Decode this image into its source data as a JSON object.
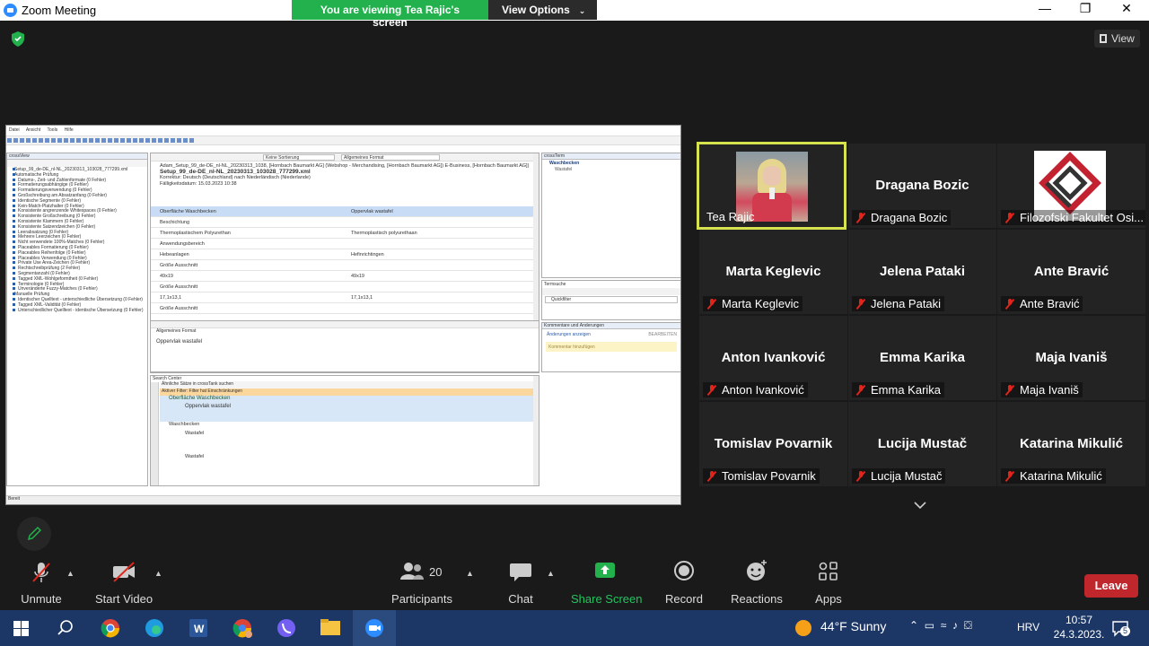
{
  "window": {
    "title": "Zoom Meeting"
  },
  "banner": {
    "viewing": "You are viewing Tea Rajic's screen",
    "view_options": "View Options"
  },
  "view_button": "View",
  "shared_screen": {
    "menu": [
      "Datei",
      "Ansicht",
      "Tools",
      "Hilfe"
    ],
    "left_pane_title": "crossView",
    "tree_items": [
      "Setup_99_de-DE_nl-NL_20230313_103028_777299.xml",
      "Automatische Prüfung",
      "Datums-, Zeit- und Zahlenformate (0 Fehler)",
      "Formatierungsabhängige (0 Fehler)",
      "Formatierungsverwendung (0 Fehler)",
      "Großschreibung am Absatzanfang (0 Fehler)",
      "Identische Segmente (0 Fehler)",
      "Kein-Match-Platzhalter (0 Fehler)",
      "Konsistente angrenzende Whitespaces (0 Fehler)",
      "Konsistente Großschreibung (0 Fehler)",
      "Konsistente Klammern (0 Fehler)",
      "Konsistente Satzendzeichen (0 Fehler)",
      "Leerabsatzung (0 Fehler)",
      "Mehrere Leerzeichen (0 Fehler)",
      "Nicht verwendete 100%-Matches (0 Fehler)",
      "Placeables Formatierung (0 Fehler)",
      "Placeables Reihenfolge (0 Fehler)",
      "Placeables Verwendung (0 Fehler)",
      "Private Use Area-Zeichen (0 Fehler)",
      "Rechtschreibprüfung (2 Fehler)",
      "Segmentanzahl (0 Fehler)",
      "Tagged XML-Wohlgeformtheit (0 Fehler)",
      "Terminologie (0 Fehler)",
      "Unveränderte Fuzzy-Matches (0 Fehler)",
      "Manuelle Prüfung",
      "Identischer Quelltext - unterschiedliche Übersetzung (0 Fehler)",
      "Tagged XML-Validität (0 Fehler)",
      "Unterschiedlicher Quelltext - identische Übersetzung (0 Fehler)"
    ],
    "toolbar_sort": "Keine Sortierung",
    "toolbar_format": "Allgemeines Format",
    "header_lines": [
      "Adam_Setup_99_de-DE_nl-NL_20230313_1038, [Hornbach Baumarkt AG] (Webshop - Merchandising, [Hornbach Baumarkt AG]) E-Business, [Hornbach Baumarkt AG])",
      "Setup_99_de-DE_nl-NL_20230313_103028_777299.xml",
      "Korrektur: Deutsch (Deutschland) nach Niederländisch (Niederlande)",
      "Fälligkeitsdatum: 15.03.2023 10:38"
    ],
    "segments": [
      {
        "src": "Oberfläche Waschbecken",
        "tgt": "Oppervlak wastafel"
      },
      {
        "src": "Beschichtung",
        "tgt": ""
      },
      {
        "src": "Thermoplastischem Polyurethan",
        "tgt": "Thermoplastisch polyurethaan"
      },
      {
        "src": "Anwendungsbereich",
        "tgt": ""
      },
      {
        "src": "Hebeanlagen",
        "tgt": "Hefinrichtingen"
      },
      {
        "src": "Größe Ausschnitt",
        "tgt": ""
      },
      {
        "src": "49x19",
        "tgt": "49x19"
      },
      {
        "src": "Größe Ausschnitt",
        "tgt": ""
      },
      {
        "src": "17,1x13,1",
        "tgt": "17,1x13,1"
      },
      {
        "src": "Größe Ausschnitt",
        "tgt": ""
      }
    ],
    "edit_format": "Allgemeines Format",
    "edit_text": "Oppervlak wastafel",
    "right_pane_title": "crossTerm",
    "term_items": [
      "Waschbecken",
      "Wastafel"
    ],
    "termsuche": "Termsuche",
    "quickfilter": "Quickfilter",
    "comments_title": "Kommentare und Änderungen",
    "changes_label": "Änderungen anzeigen",
    "edit_label": "BEARBEITEN",
    "comment_placeholder": "Kommentar hinzufügen",
    "search_center": "Search Center",
    "search_similar": "Ähnliche Sätze in crossTank suchen",
    "active_filter": "Aktiver Filter: Filter hat Einschränkungen",
    "results": [
      "Oberfläche Waschbecken",
      "Oppervlak wastafel",
      "Waschbecken",
      "Wastafel",
      "Wastafel"
    ],
    "status": "Bereit"
  },
  "participants": [
    {
      "name": "Tea Rajic",
      "big": ""
    },
    {
      "name": "Dragana Bozic",
      "big": "Dragana Bozic"
    },
    {
      "name": "Filozofski Fakultet Osi...",
      "big": ""
    },
    {
      "name": "Marta Keglevic",
      "big": "Marta Keglevic"
    },
    {
      "name": "Jelena Pataki",
      "big": "Jelena Pataki"
    },
    {
      "name": "Ante Bravić",
      "big": "Ante Bravić"
    },
    {
      "name": "Anton Ivanković",
      "big": "Anton Ivanković"
    },
    {
      "name": "Emma Karika",
      "big": "Emma Karika"
    },
    {
      "name": "Maja Ivaniš",
      "big": "Maja Ivaniš"
    },
    {
      "name": "Tomislav Povarnik",
      "big": "Tomislav Povarnik"
    },
    {
      "name": "Lucija Mustač",
      "big": "Lucija Mustač"
    },
    {
      "name": "Katarina Mikulić",
      "big": "Katarina Mikulić"
    }
  ],
  "controls": {
    "unmute": "Unmute",
    "start_video": "Start Video",
    "participants": "Participants",
    "participant_count": "20",
    "chat": "Chat",
    "share_screen": "Share Screen",
    "record": "Record",
    "reactions": "Reactions",
    "apps": "Apps",
    "leave": "Leave"
  },
  "taskbar": {
    "weather_temp": "44°F",
    "weather": "Sunny",
    "lang": "HRV",
    "time": "10:57",
    "date": "24.3.2023.",
    "notifications": "5"
  },
  "colors": {
    "share_green": "#22b14c",
    "leave_red": "#c0272d",
    "active_border": "#d7e34e",
    "taskbar": "#1c3766"
  }
}
